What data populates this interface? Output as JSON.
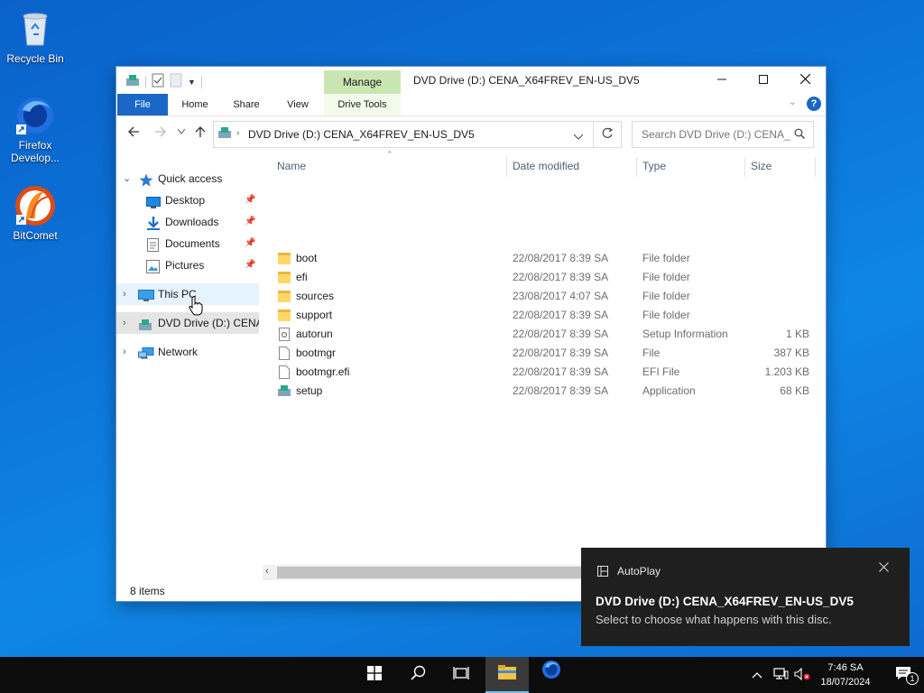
{
  "desktop": {
    "icons": [
      {
        "label": "Recycle Bin"
      },
      {
        "label": "Firefox Develop..."
      },
      {
        "label": "BitComet"
      }
    ]
  },
  "window": {
    "title": "DVD Drive (D:) CENA_X64FREV_EN-US_DV5",
    "context_tab": "Manage",
    "ribbon_tabs": [
      "File",
      "Home",
      "Share",
      "View",
      "Drive Tools"
    ],
    "address_path": "DVD Drive (D:) CENA_X64FREV_EN-US_DV5",
    "search_placeholder": "Search DVD Drive (D:) CENA_...",
    "status": "8 items"
  },
  "nav": {
    "quick_access": "Quick access",
    "items": [
      {
        "label": "Desktop",
        "icon": "desktop-icon"
      },
      {
        "label": "Downloads",
        "icon": "downloads-icon"
      },
      {
        "label": "Documents",
        "icon": "documents-icon"
      },
      {
        "label": "Pictures",
        "icon": "pictures-icon"
      }
    ],
    "this_pc": "This PC",
    "dvd_drive": "DVD Drive (D:) CENA_",
    "network": "Network"
  },
  "columns": {
    "name": "Name",
    "date": "Date modified",
    "type": "Type",
    "size": "Size"
  },
  "files": [
    {
      "name": "boot",
      "date": "22/08/2017 8:39 SA",
      "type": "File folder",
      "size": "",
      "icon": "folder"
    },
    {
      "name": "efi",
      "date": "22/08/2017 8:39 SA",
      "type": "File folder",
      "size": "",
      "icon": "folder"
    },
    {
      "name": "sources",
      "date": "23/08/2017 4:07 SA",
      "type": "File folder",
      "size": "",
      "icon": "folder"
    },
    {
      "name": "support",
      "date": "22/08/2017 8:39 SA",
      "type": "File folder",
      "size": "",
      "icon": "folder"
    },
    {
      "name": "autorun",
      "date": "22/08/2017 8:39 SA",
      "type": "Setup Information",
      "size": "1 KB",
      "icon": "settings-file"
    },
    {
      "name": "bootmgr",
      "date": "22/08/2017 8:39 SA",
      "type": "File",
      "size": "387 KB",
      "icon": "file"
    },
    {
      "name": "bootmgr.efi",
      "date": "22/08/2017 8:39 SA",
      "type": "EFI File",
      "size": "1.203 KB",
      "icon": "file"
    },
    {
      "name": "setup",
      "date": "22/08/2017 8:39 SA",
      "type": "Application",
      "size": "68 KB",
      "icon": "setup"
    }
  ],
  "toast": {
    "app": "AutoPlay",
    "title": "DVD Drive (D:) CENA_X64FREV_EN-US_DV5",
    "message": "Select to choose what happens with this disc."
  },
  "taskbar": {
    "time": "7:46 SA",
    "date": "18/07/2024",
    "notifications_count": "1"
  },
  "colors": {
    "accent": "#1a67c7",
    "manage_tab": "#c9e6b2",
    "folder": "#ffd767",
    "toast_bg": "#1f1f1f",
    "taskbar_bg": "#0c0c0c"
  }
}
